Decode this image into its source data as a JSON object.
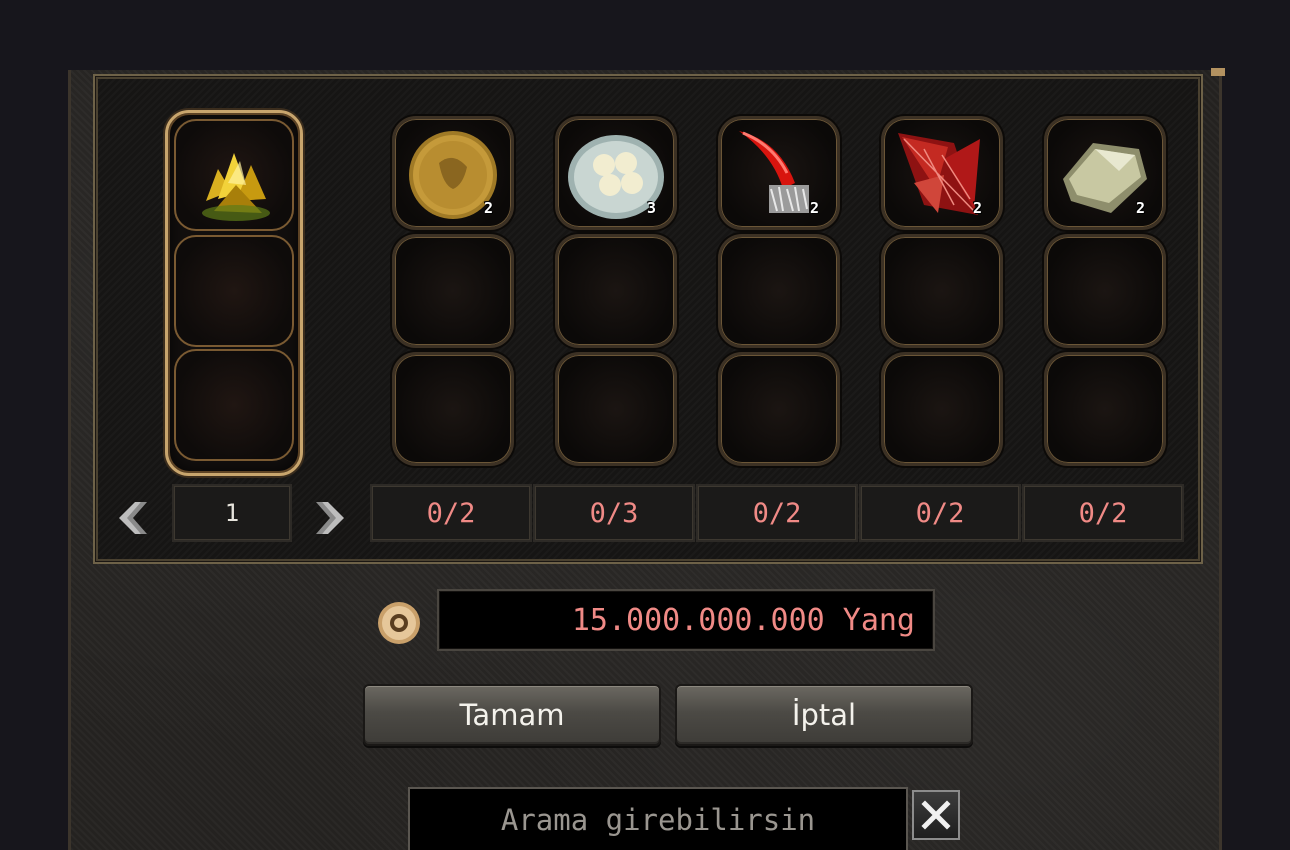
{
  "result_slots": [
    {
      "item": "yellow-gem-ore",
      "quantity": null
    },
    {
      "item": "",
      "quantity": null
    },
    {
      "item": "",
      "quantity": null
    }
  ],
  "materials": [
    {
      "icon": "gold-coin-icon",
      "quantity": "2",
      "counter": "0/2"
    },
    {
      "icon": "dumplings-bowl-icon",
      "quantity": "3",
      "counter": "0/3"
    },
    {
      "icon": "red-claw-icon",
      "quantity": "2",
      "counter": "0/2"
    },
    {
      "icon": "red-crystal-icon",
      "quantity": "2",
      "counter": "0/2"
    },
    {
      "icon": "pale-stone-icon",
      "quantity": "2",
      "counter": "0/2"
    }
  ],
  "pagination": {
    "page": "1"
  },
  "cost": {
    "value": "15.000.000.000 Yang",
    "icon": "yang-coin-icon"
  },
  "buttons": {
    "confirm": "Tamam",
    "cancel": "İptal"
  },
  "search": {
    "placeholder": "Arama girebilirsin"
  },
  "colors": {
    "counter_text": "#f08a86",
    "frame_gold": "#c8a56d"
  }
}
